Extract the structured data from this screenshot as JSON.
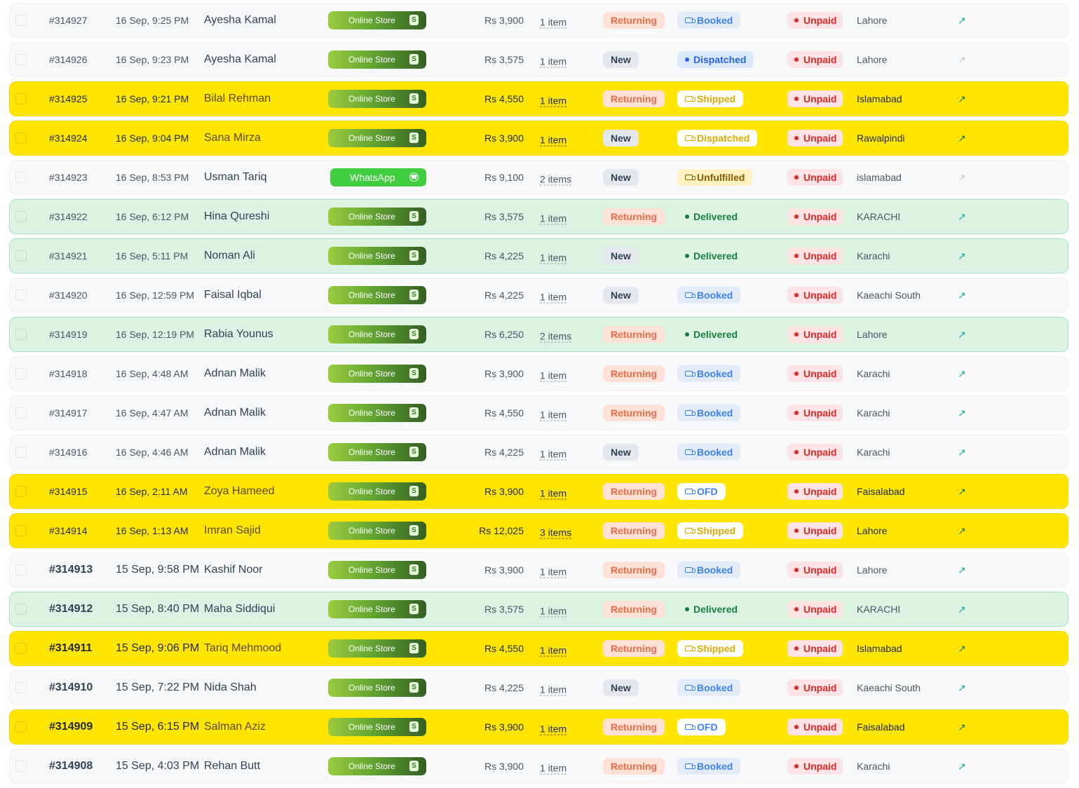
{
  "orders": [
    {
      "id": "#314927",
      "date": "16 Sep, 9:25 PM",
      "customer": "Ayesha Kamal",
      "channel": "Online Store",
      "channel_type": "store",
      "amount": "Rs 3,900",
      "items": "1 item",
      "customer_type": "Returning",
      "fulfillment": "Booked",
      "fulfillment_style": "booked",
      "payment": "Unpaid",
      "city": "Lahore",
      "highlight": "none",
      "link_active": true,
      "large": false
    },
    {
      "id": "#314926",
      "date": "16 Sep, 9:23 PM",
      "customer": "Ayesha Kamal",
      "channel": "Online Store",
      "channel_type": "store",
      "amount": "Rs 3,575",
      "items": "1 item",
      "customer_type": "New",
      "fulfillment": "Dispatched",
      "fulfillment_style": "dispatched-blue",
      "payment": "Unpaid",
      "city": "Lahore",
      "highlight": "none",
      "link_active": false,
      "large": false
    },
    {
      "id": "#314925",
      "date": "16 Sep, 9:21 PM",
      "customer": "Bilal Rehman",
      "channel": "Online Store",
      "channel_type": "store",
      "amount": "Rs 4,550",
      "items": "1 item",
      "customer_type": "Returning",
      "fulfillment": "Shipped",
      "fulfillment_style": "yellowpill",
      "payment": "Unpaid",
      "city": "Islamabad",
      "highlight": "yellow",
      "link_active": true,
      "large": false
    },
    {
      "id": "#314924",
      "date": "16 Sep, 9:04 PM",
      "customer": "Sana Mirza",
      "channel": "Online Store",
      "channel_type": "store",
      "amount": "Rs 3,900",
      "items": "1 item",
      "customer_type": "New",
      "fulfillment": "Dispatched",
      "fulfillment_style": "yellowpill",
      "payment": "Unpaid",
      "city": "Rawalpindi",
      "highlight": "yellow",
      "link_active": true,
      "large": false
    },
    {
      "id": "#314923",
      "date": "16 Sep, 8:53 PM",
      "customer": "Usman Tariq",
      "channel": "WhatsApp",
      "channel_type": "whatsapp",
      "amount": "Rs 9,100",
      "items": "2 items",
      "customer_type": "New",
      "fulfillment": "Unfulfilled",
      "fulfillment_style": "unfulfilled",
      "payment": "Unpaid",
      "city": "islamabad",
      "highlight": "none",
      "link_active": false,
      "large": false
    },
    {
      "id": "#314922",
      "date": "16 Sep, 6:12 PM",
      "customer": "Hina Qureshi",
      "channel": "Online Store",
      "channel_type": "store",
      "amount": "Rs 3,575",
      "items": "1 item",
      "customer_type": "Returning",
      "fulfillment": "Delivered",
      "fulfillment_style": "delivered",
      "payment": "Unpaid",
      "city": "KARACHI",
      "highlight": "green",
      "link_active": true,
      "large": false
    },
    {
      "id": "#314921",
      "date": "16 Sep, 5:11 PM",
      "customer": "Noman Ali",
      "channel": "Online Store",
      "channel_type": "store",
      "amount": "Rs 4,225",
      "items": "1 item",
      "customer_type": "New",
      "fulfillment": "Delivered",
      "fulfillment_style": "delivered",
      "payment": "Unpaid",
      "city": "Karachi",
      "highlight": "green",
      "link_active": true,
      "large": false
    },
    {
      "id": "#314920",
      "date": "16 Sep, 12:59 PM",
      "customer": "Faisal Iqbal",
      "channel": "Online Store",
      "channel_type": "store",
      "amount": "Rs 4,225",
      "items": "1 item",
      "customer_type": "New",
      "fulfillment": "Booked",
      "fulfillment_style": "booked",
      "payment": "Unpaid",
      "city": "Kaeachi South",
      "highlight": "none",
      "link_active": true,
      "large": false
    },
    {
      "id": "#314919",
      "date": "16 Sep, 12:19 PM",
      "customer": "Rabia Younus",
      "channel": "Online Store",
      "channel_type": "store",
      "amount": "Rs 6,250",
      "items": "2 items",
      "customer_type": "Returning",
      "fulfillment": "Delivered",
      "fulfillment_style": "delivered",
      "payment": "Unpaid",
      "city": "Lahore",
      "highlight": "green",
      "link_active": true,
      "large": false
    },
    {
      "id": "#314918",
      "date": "16 Sep, 4:48 AM",
      "customer": "Adnan Malik",
      "channel": "Online Store",
      "channel_type": "store",
      "amount": "Rs 3,900",
      "items": "1 item",
      "customer_type": "Returning",
      "fulfillment": "Booked",
      "fulfillment_style": "booked",
      "payment": "Unpaid",
      "city": "Karachi",
      "highlight": "none",
      "link_active": true,
      "large": false
    },
    {
      "id": "#314917",
      "date": "16 Sep, 4:47 AM",
      "customer": "Adnan Malik",
      "channel": "Online Store",
      "channel_type": "store",
      "amount": "Rs 4,550",
      "items": "1 item",
      "customer_type": "Returning",
      "fulfillment": "Booked",
      "fulfillment_style": "booked",
      "payment": "Unpaid",
      "city": "Karachi",
      "highlight": "none",
      "link_active": true,
      "large": false
    },
    {
      "id": "#314916",
      "date": "16 Sep, 4:46 AM",
      "customer": "Adnan Malik",
      "channel": "Online Store",
      "channel_type": "store",
      "amount": "Rs 4,225",
      "items": "1 item",
      "customer_type": "New",
      "fulfillment": "Booked",
      "fulfillment_style": "booked",
      "payment": "Unpaid",
      "city": "Karachi",
      "highlight": "none",
      "link_active": true,
      "large": false
    },
    {
      "id": "#314915",
      "date": "16 Sep, 2:11 AM",
      "customer": "Zoya Hameed",
      "channel": "Online Store",
      "channel_type": "store",
      "amount": "Rs 3,900",
      "items": "1 item",
      "customer_type": "Returning",
      "fulfillment": "OFD",
      "fulfillment_style": "ofd",
      "payment": "Unpaid",
      "city": "Faisalabad",
      "highlight": "yellow",
      "link_active": true,
      "large": false
    },
    {
      "id": "#314914",
      "date": "16 Sep, 1:13 AM",
      "customer": "Imran Sajid",
      "channel": "Online Store",
      "channel_type": "store",
      "amount": "Rs 12,025",
      "items": "3 items",
      "customer_type": "Returning",
      "fulfillment": "Shipped",
      "fulfillment_style": "yellowpill",
      "payment": "Unpaid",
      "city": "Lahore",
      "highlight": "yellow",
      "link_active": true,
      "large": false
    },
    {
      "id": "#314913",
      "date": "15 Sep, 9:58 PM",
      "customer": "Kashif Noor",
      "channel": "Online Store",
      "channel_type": "store",
      "amount": "Rs 3,900",
      "items": "1 item",
      "customer_type": "Returning",
      "fulfillment": "Booked",
      "fulfillment_style": "booked",
      "payment": "Unpaid",
      "city": "Lahore",
      "highlight": "none",
      "link_active": true,
      "large": true
    },
    {
      "id": "#314912",
      "date": "15 Sep, 8:40 PM",
      "customer": "Maha Siddiqui",
      "channel": "Online Store",
      "channel_type": "store",
      "amount": "Rs 3,575",
      "items": "1 item",
      "customer_type": "Returning",
      "fulfillment": "Delivered",
      "fulfillment_style": "delivered",
      "payment": "Unpaid",
      "city": "KARACHI",
      "highlight": "green",
      "link_active": true,
      "large": true
    },
    {
      "id": "#314911",
      "date": "15 Sep, 9:06 PM",
      "customer": "Tariq Mehmood",
      "channel": "Online Store",
      "channel_type": "store",
      "amount": "Rs 4,550",
      "items": "1 item",
      "customer_type": "Returning",
      "fulfillment": "Shipped",
      "fulfillment_style": "yellowpill",
      "payment": "Unpaid",
      "city": "Islamabad",
      "highlight": "yellow",
      "link_active": true,
      "large": true
    },
    {
      "id": "#314910",
      "date": "15 Sep, 7:22 PM",
      "customer": "Nida Shah",
      "channel": "Online Store",
      "channel_type": "store",
      "amount": "Rs 4,225",
      "items": "1 item",
      "customer_type": "New",
      "fulfillment": "Booked",
      "fulfillment_style": "booked",
      "payment": "Unpaid",
      "city": "Kaeachi South",
      "highlight": "none",
      "link_active": true,
      "large": true
    },
    {
      "id": "#314909",
      "date": "15 Sep, 6:15 PM",
      "customer": "Salman Aziz",
      "channel": "Online Store",
      "channel_type": "store",
      "amount": "Rs 3,900",
      "items": "1 item",
      "customer_type": "Returning",
      "fulfillment": "OFD",
      "fulfillment_style": "ofd",
      "payment": "Unpaid",
      "city": "Faisalabad",
      "highlight": "yellow",
      "link_active": true,
      "large": true
    },
    {
      "id": "#314908",
      "date": "15 Sep, 4:03 PM",
      "customer": "Rehan Butt",
      "channel": "Online Store",
      "channel_type": "store",
      "amount": "Rs 3,900",
      "items": "1 item",
      "customer_type": "Returning",
      "fulfillment": "Booked",
      "fulfillment_style": "booked",
      "payment": "Unpaid",
      "city": "Karachi",
      "highlight": "none",
      "link_active": true,
      "large": true
    }
  ],
  "icons": {
    "store": "shopify-bag-icon",
    "whatsapp": "whatsapp-icon",
    "fulfillment": "truck-icon",
    "open": "external-link-arrow-icon"
  },
  "colors": {
    "highlight_yellow": "#ffe500",
    "highlight_green": "#dcf3e4",
    "returning": "#ef6b46",
    "unpaid": "#dc2626",
    "delivered": "#15803d",
    "booked": "#3b82f6",
    "link": "#17a9a0"
  }
}
